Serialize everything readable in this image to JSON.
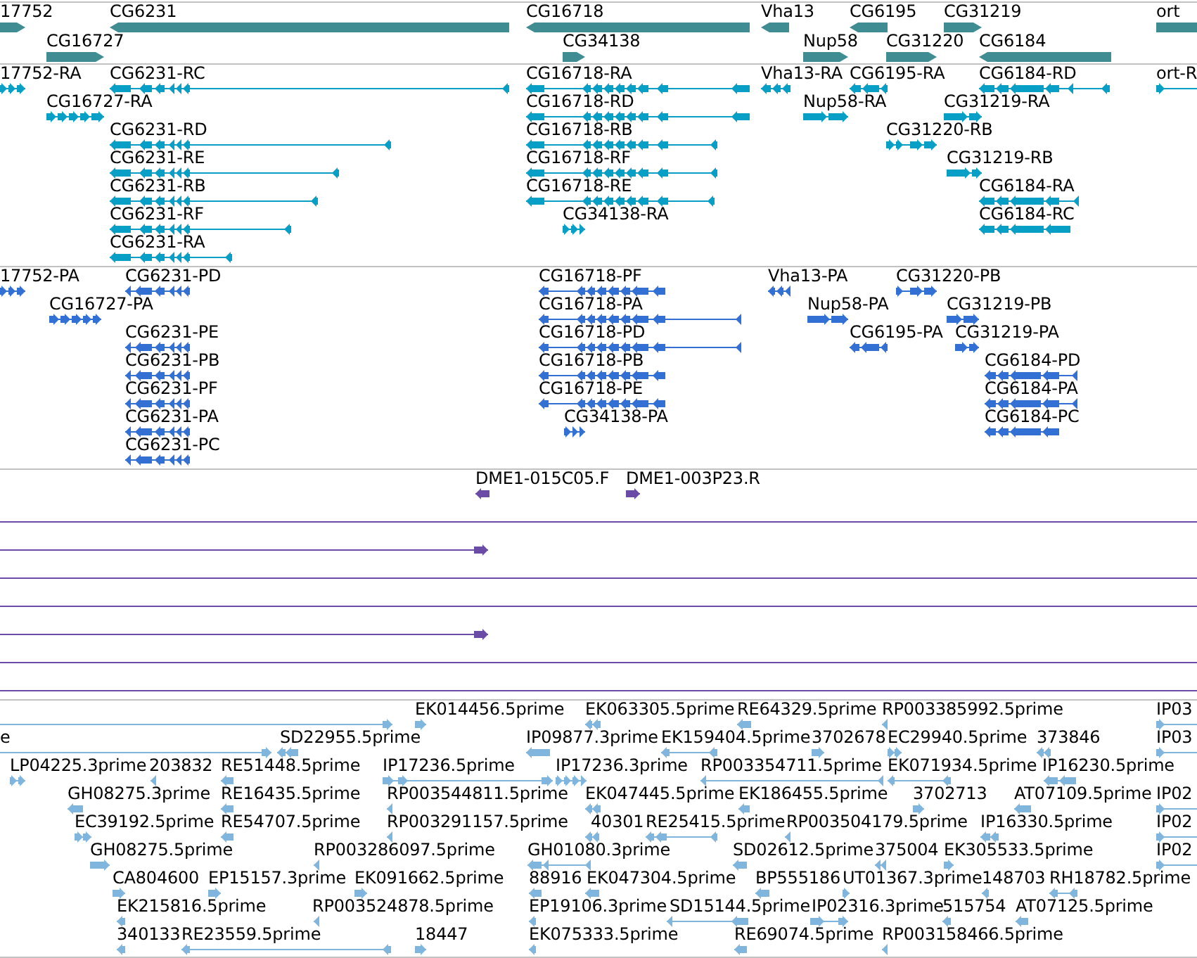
{
  "tracks": [
    {
      "kind": "gene",
      "rows": [
        {
          "features": [
            {
              "label": "17752",
              "reverse": false
            },
            {
              "label": "CG6231",
              "reverse": true
            },
            {
              "label": "CG16718",
              "reverse": true
            },
            {
              "label": "Vha13",
              "reverse": true
            },
            {
              "label": "CG6195",
              "reverse": true
            },
            {
              "label": "CG31219",
              "reverse": false
            },
            {
              "label": "ort",
              "reverse": false
            }
          ]
        },
        {
          "features": [
            {
              "label": "CG16727",
              "reverse": false
            },
            {
              "label": "CG34138",
              "reverse": false
            },
            {
              "label": "Nup58",
              "reverse": false
            },
            {
              "label": "CG31220",
              "reverse": false
            },
            {
              "label": "CG6184",
              "reverse": true
            }
          ]
        }
      ]
    },
    {
      "kind": "transcript",
      "rows": [
        {
          "features": [
            {
              "label": "17752-RA",
              "reverse": false
            },
            {
              "label": "CG6231-RC",
              "reverse": true
            },
            {
              "label": "CG16718-RA",
              "reverse": true
            },
            {
              "label": "Vha13-RA",
              "reverse": true
            },
            {
              "label": "CG6195-RA",
              "reverse": true
            },
            {
              "label": "CG6184-RD",
              "reverse": true
            },
            {
              "label": "ort-R",
              "reverse": false
            }
          ]
        },
        {
          "features": [
            {
              "label": "CG16727-RA",
              "reverse": false
            },
            {
              "label": "CG16718-RD",
              "reverse": true
            },
            {
              "label": "Nup58-RA",
              "reverse": false
            },
            {
              "label": "CG31219-RA",
              "reverse": false
            }
          ]
        },
        {
          "features": [
            {
              "label": "CG6231-RD",
              "reverse": true
            },
            {
              "label": "CG16718-RB",
              "reverse": true
            },
            {
              "label": "CG31220-RB",
              "reverse": false
            }
          ]
        },
        {
          "features": [
            {
              "label": "CG6231-RE",
              "reverse": true
            },
            {
              "label": "CG16718-RF",
              "reverse": true
            },
            {
              "label": "CG31219-RB",
              "reverse": false
            }
          ]
        },
        {
          "features": [
            {
              "label": "CG6231-RB",
              "reverse": true
            },
            {
              "label": "CG16718-RE",
              "reverse": true
            },
            {
              "label": "CG6184-RA",
              "reverse": true
            }
          ]
        },
        {
          "features": [
            {
              "label": "CG6231-RF",
              "reverse": true
            },
            {
              "label": "CG34138-RA",
              "reverse": false
            },
            {
              "label": "CG6184-RC",
              "reverse": true
            }
          ]
        },
        {
          "features": [
            {
              "label": "CG6231-RA",
              "reverse": true
            }
          ]
        }
      ]
    },
    {
      "kind": "protein",
      "rows": [
        {
          "features": [
            {
              "label": "17752-PA",
              "reverse": false
            },
            {
              "label": "CG6231-PD",
              "reverse": true
            },
            {
              "label": "CG16718-PF",
              "reverse": true
            },
            {
              "label": "Vha13-PA",
              "reverse": true
            },
            {
              "label": "CG31220-PB",
              "reverse": false
            }
          ]
        },
        {
          "features": [
            {
              "label": "CG16727-PA",
              "reverse": false
            },
            {
              "label": "CG16718-PA",
              "reverse": true
            },
            {
              "label": "Nup58-PA",
              "reverse": false
            },
            {
              "label": "CG31219-PB",
              "reverse": false
            }
          ]
        },
        {
          "features": [
            {
              "label": "CG6231-PE",
              "reverse": true
            },
            {
              "label": "CG16718-PD",
              "reverse": true
            },
            {
              "label": "CG6195-PA",
              "reverse": true
            },
            {
              "label": "CG31219-PA",
              "reverse": false
            }
          ]
        },
        {
          "features": [
            {
              "label": "CG6231-PB",
              "reverse": true
            },
            {
              "label": "CG16718-PB",
              "reverse": true
            },
            {
              "label": "CG6184-PD",
              "reverse": true
            }
          ]
        },
        {
          "features": [
            {
              "label": "CG6231-PF",
              "reverse": true
            },
            {
              "label": "CG16718-PE",
              "reverse": true
            },
            {
              "label": "CG6184-PA",
              "reverse": true
            }
          ]
        },
        {
          "features": [
            {
              "label": "CG6231-PA",
              "reverse": true
            },
            {
              "label": "CG34138-PA",
              "reverse": false
            },
            {
              "label": "CG6184-PC",
              "reverse": true
            }
          ]
        },
        {
          "features": [
            {
              "label": "CG6231-PC",
              "reverse": true
            }
          ]
        }
      ]
    },
    {
      "kind": "clone",
      "rows": [
        {
          "features": [
            {
              "kind": "read",
              "label": "DME1-015C05.F",
              "reverse": true
            },
            {
              "kind": "read",
              "label": "DME1-003P23.R",
              "reverse": false
            }
          ]
        },
        {
          "features": [
            {
              "kind": "span"
            }
          ]
        },
        {
          "features": [
            {
              "kind": "read",
              "reverse": false
            }
          ]
        },
        {
          "features": [
            {
              "kind": "span"
            }
          ]
        },
        {
          "features": [
            {
              "kind": "span"
            }
          ]
        },
        {
          "features": [
            {
              "kind": "read",
              "reverse": false
            }
          ]
        },
        {
          "features": [
            {
              "kind": "span"
            }
          ]
        },
        {
          "features": [
            {
              "kind": "span"
            }
          ]
        }
      ]
    },
    {
      "kind": "est",
      "rows": [
        {
          "features": [
            {
              "reverse": false
            },
            {
              "label": "EK014456.5prime",
              "reverse": false
            },
            {
              "label": "EK063305.5prime",
              "reverse": true
            },
            {
              "label": "RE64329.5prime",
              "reverse": true
            },
            {
              "label": "RP003385992.5prime",
              "reverse": true
            },
            {
              "label": "IP03",
              "reverse": false
            }
          ]
        },
        {
          "features": [
            {
              "label": "e",
              "reverse": false
            },
            {
              "label": "SD22955.5prime",
              "reverse": true
            },
            {
              "label": "IP09877.3prime",
              "reverse": true
            },
            {
              "label": "EK159404.5prime",
              "reverse": true
            },
            {
              "label": "3702678",
              "reverse": false
            },
            {
              "label": "EC29940.5prime",
              "reverse": false
            },
            {
              "label": "373846",
              "reverse": true
            },
            {
              "label": "IP03",
              "reverse": false
            }
          ]
        },
        {
          "features": [
            {
              "label": "LP04225.3prime",
              "reverse": false
            },
            {
              "label": "203832",
              "reverse": true
            },
            {
              "label": "RE51448.5prime",
              "reverse": true
            },
            {
              "label": "IP17236.5prime",
              "reverse": false
            },
            {
              "label": "IP17236.3prime",
              "reverse": false
            },
            {
              "label": "RP003354711.5prime",
              "reverse": true
            },
            {
              "label": "EK071934.5prime",
              "reverse": true
            },
            {
              "label": "IP16230.5prime",
              "reverse": true
            }
          ]
        },
        {
          "features": [
            {
              "label": "GH08275.3prime",
              "reverse": true
            },
            {
              "label": "RE16435.5prime",
              "reverse": true
            },
            {
              "label": "RP003544811.5prime",
              "reverse": true
            },
            {
              "label": "EK047445.5prime",
              "reverse": true
            },
            {
              "label": "EK186455.5prime",
              "reverse": true
            },
            {
              "label": "3702713",
              "reverse": false
            },
            {
              "label": "AT07109.5prime",
              "reverse": true
            },
            {
              "label": "IP02",
              "reverse": false
            }
          ]
        },
        {
          "features": [
            {
              "label": "EC39192.5prime",
              "reverse": false
            },
            {
              "label": "RE54707.5prime",
              "reverse": true
            },
            {
              "label": "RP003291157.5prime",
              "reverse": true
            },
            {
              "label": "40301",
              "reverse": true
            },
            {
              "label": "RE25415.5prime",
              "reverse": true
            },
            {
              "label": "RP003504179.5prime",
              "reverse": true
            },
            {
              "label": "IP16330.5prime",
              "reverse": true
            },
            {
              "label": "IP02",
              "reverse": false
            }
          ]
        },
        {
          "features": [
            {
              "label": "GH08275.5prime",
              "reverse": false
            },
            {
              "label": "RP003286097.5prime",
              "reverse": true
            },
            {
              "label": "GH01080.3prime",
              "reverse": true
            },
            {
              "label": "SD02612.5prime",
              "reverse": true
            },
            {
              "label": "375004",
              "reverse": true
            },
            {
              "label": "EK305533.5prime",
              "reverse": false
            },
            {
              "label": "IP02",
              "reverse": false
            }
          ]
        },
        {
          "features": [
            {
              "label": "CA804600",
              "reverse": false
            },
            {
              "label": "EP15157.3prime",
              "reverse": false
            },
            {
              "label": "EK091662.5prime",
              "reverse": false
            },
            {
              "label": "88916",
              "reverse": true
            },
            {
              "label": "EK047304.5prime",
              "reverse": true
            },
            {
              "label": "BP555186",
              "reverse": true
            },
            {
              "label": "UT01367.3prime",
              "reverse": false
            },
            {
              "label": "148703",
              "reverse": true
            },
            {
              "label": "RH18782.5prime",
              "reverse": true
            }
          ]
        },
        {
          "features": [
            {
              "label": "EK215816.5prime",
              "reverse": true
            },
            {
              "label": "RP003524878.5prime",
              "reverse": true
            },
            {
              "label": "EP19106.3prime",
              "reverse": true
            },
            {
              "label": "SD15144.5prime",
              "reverse": true
            },
            {
              "label": "IP02316.3prime",
              "reverse": false
            },
            {
              "label": "515754",
              "reverse": true
            },
            {
              "label": "AT07125.5prime",
              "reverse": true
            }
          ]
        },
        {
          "features": [
            {
              "label": "340133",
              "reverse": true
            },
            {
              "label": "RE23559.5prime",
              "reverse": true
            },
            {
              "label": "18447",
              "reverse": false
            },
            {
              "label": "EK075333.5prime",
              "reverse": true
            },
            {
              "label": "RE69074.5prime",
              "reverse": true
            },
            {
              "label": "RP003158466.5prime",
              "reverse": true
            }
          ]
        }
      ]
    }
  ]
}
